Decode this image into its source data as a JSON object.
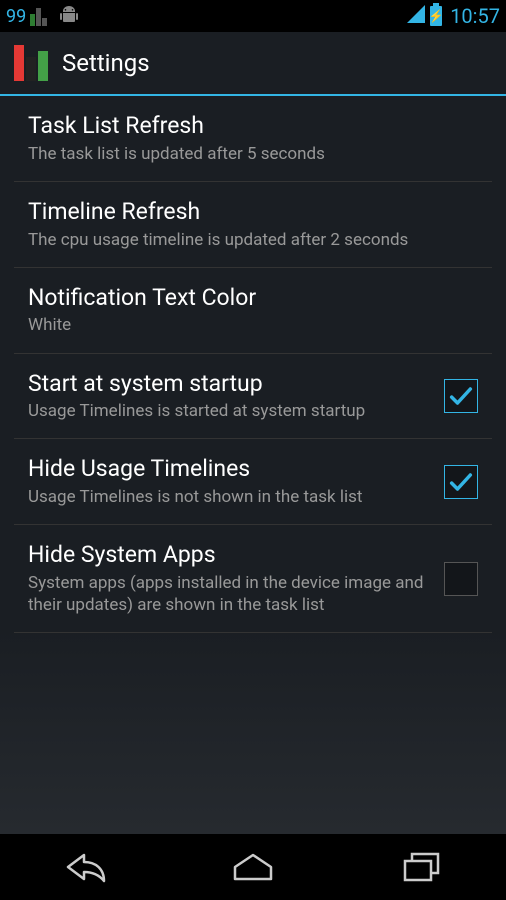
{
  "status": {
    "leftNum": "99",
    "time": "10:57"
  },
  "header": {
    "title": "Settings"
  },
  "settings": [
    {
      "title": "Task List Refresh",
      "sub": "The task list is updated after 5 seconds",
      "hasCheckbox": false
    },
    {
      "title": "Timeline Refresh",
      "sub": "The cpu usage timeline is updated after 2 seconds",
      "hasCheckbox": false
    },
    {
      "title": "Notification Text Color",
      "sub": "White",
      "hasCheckbox": false
    },
    {
      "title": "Start at system startup",
      "sub": "Usage Timelines is started at system startup",
      "hasCheckbox": true,
      "checked": true
    },
    {
      "title": "Hide Usage Timelines",
      "sub": "Usage Timelines is not shown in the task list",
      "hasCheckbox": true,
      "checked": true
    },
    {
      "title": "Hide System Apps",
      "sub": "System apps (apps installed in the device image and their updates) are shown in the task list",
      "hasCheckbox": true,
      "checked": false
    }
  ]
}
